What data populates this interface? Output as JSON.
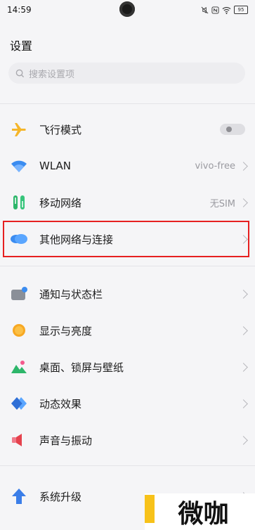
{
  "status_bar": {
    "time": "14:59",
    "battery": "95"
  },
  "page": {
    "title": "设置"
  },
  "search": {
    "placeholder": "搜索设置项"
  },
  "settings": {
    "airplane": {
      "label": "飞行模式",
      "enabled": false,
      "icon": "airplane-icon"
    },
    "wlan": {
      "label": "WLAN",
      "value": "vivo-free",
      "icon": "wifi-icon"
    },
    "mobile": {
      "label": "移动网络",
      "value": "无SIM",
      "icon": "mobile-network-icon"
    },
    "other": {
      "label": "其他网络与连接",
      "icon": "cloud-icon"
    },
    "notify": {
      "label": "通知与状态栏",
      "icon": "notification-icon"
    },
    "display": {
      "label": "显示与亮度",
      "icon": "sun-icon"
    },
    "desktop": {
      "label": "桌面、锁屏与壁纸",
      "icon": "wallpaper-icon"
    },
    "effects": {
      "label": "动态效果",
      "icon": "diamond-icon"
    },
    "sound": {
      "label": "声音与振动",
      "icon": "speaker-icon"
    },
    "update": {
      "label": "系统升级",
      "icon": "arrow-up-icon"
    }
  },
  "colors": {
    "highlight": "#e62020",
    "accent_blue": "#3b8cf0",
    "watermark_yellow": "#f7c21a"
  },
  "watermark": {
    "text": "微咖"
  }
}
